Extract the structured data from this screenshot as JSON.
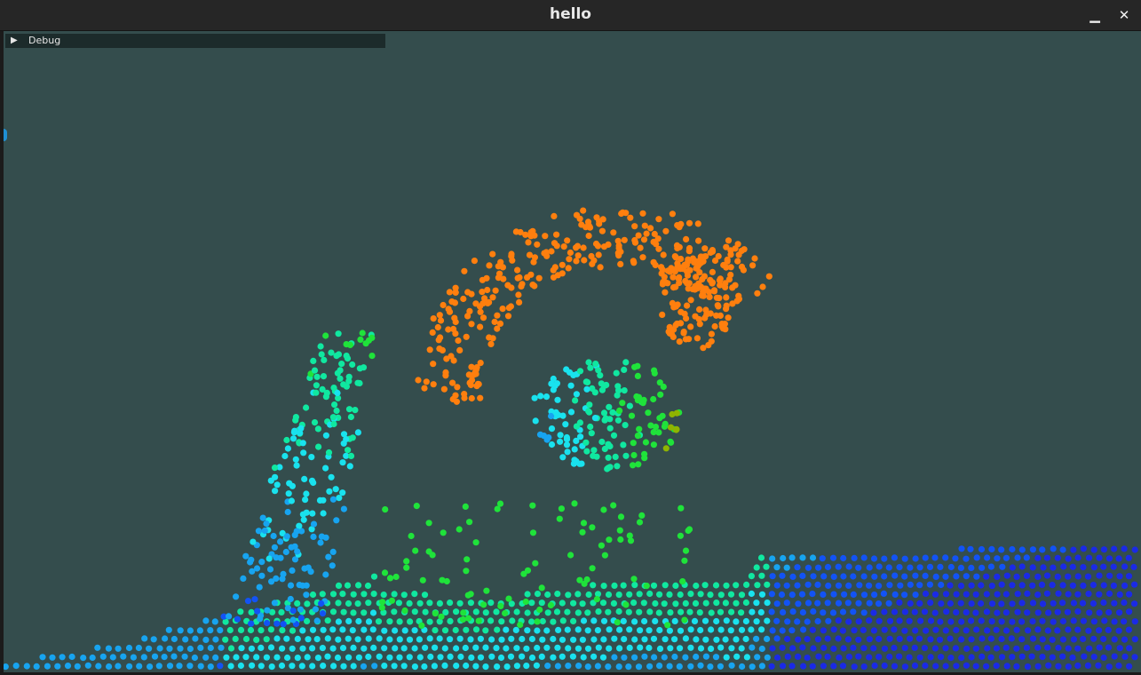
{
  "window": {
    "title": "hello",
    "minimize_glyph": "▁",
    "close_glyph": "✕"
  },
  "debug_panel": {
    "arrow": "▶",
    "label": "Debug"
  },
  "colors": {
    "background": "#344d4d",
    "orange": "#ff7f0e",
    "yellow_green": "#8fb400",
    "green": "#1fe33a",
    "teal": "#10e8a0",
    "cyan": "#19e2ee",
    "light_blue": "#17a4f0",
    "blue": "#1253f5",
    "deep_blue": "#1a2ae6"
  }
}
